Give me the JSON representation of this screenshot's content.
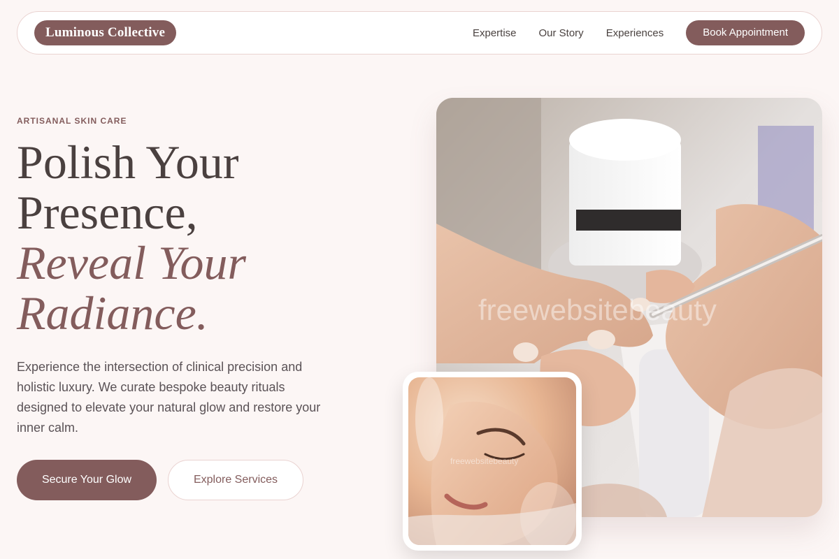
{
  "nav": {
    "brand": "Luminous Collective",
    "links": [
      "Expertise",
      "Our Story",
      "Experiences"
    ],
    "cta": "Book Appointment"
  },
  "hero": {
    "eyebrow": "ARTISANAL SKIN CARE",
    "headline_line1": "Polish Your",
    "headline_line2": "Presence,",
    "headline_accent1": "Reveal Your",
    "headline_accent2": "Radiance.",
    "lead": "Experience the intersection of clinical precision and holistic luxury. We curate bespoke beauty rituals designed to elevate your natural glow and restore your inner calm.",
    "primary_button": "Secure Your Glow",
    "secondary_button": "Explore Services"
  },
  "images": {
    "main_watermark": "freewebsitebeauty",
    "sub_watermark": "freewebsitebeauty",
    "main_icon": "manicure-photo",
    "sub_icon": "facial-treatment-photo"
  },
  "colors": {
    "accent": "#835c5c",
    "background": "#fcf6f5",
    "text": "#4a403f"
  }
}
